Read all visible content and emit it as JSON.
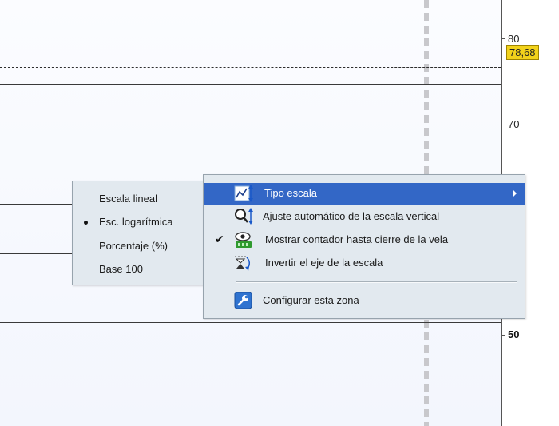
{
  "price_axis": {
    "ticks": [
      {
        "label": "80",
        "bold": false
      },
      {
        "label": "70",
        "bold": false
      },
      {
        "label": "50",
        "bold": true
      }
    ],
    "current_price": "78,68",
    "current_price_color": "#f2d21b"
  },
  "submenu": {
    "items": [
      {
        "label": "Escala lineal",
        "selected": false
      },
      {
        "label": "Esc. logarítmica",
        "selected": true
      },
      {
        "label": "Porcentaje (%)",
        "selected": false
      },
      {
        "label": "Base 100",
        "selected": false
      }
    ]
  },
  "context_menu": {
    "items": [
      {
        "label": "Tipo escala",
        "icon": "scale-type-icon",
        "highlighted": true,
        "has_submenu": true
      },
      {
        "label": "Ajuste automático de la escala vertical",
        "icon": "zoom-autofit-icon"
      },
      {
        "label": "Mostrar contador hasta cierre de la vela",
        "icon": "eye-counter-icon",
        "checked": true
      },
      {
        "label": "Invertir el eje de la escala",
        "icon": "invert-axis-icon"
      },
      {
        "label": "Configurar esta zona",
        "icon": "wrench-settings-icon"
      }
    ],
    "highlight_color": "#3367c6"
  }
}
